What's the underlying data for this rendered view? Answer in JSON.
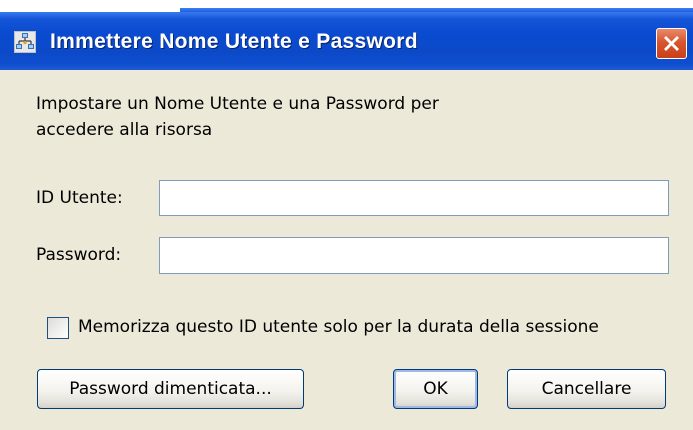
{
  "dialog": {
    "title": "Immettere Nome Utente e Password",
    "message_line1": "Impostare un Nome Utente e una Password per",
    "message_line2": "accedere alla risorsa",
    "user_id_label": "ID Utente:",
    "user_id_value": "",
    "password_label": "Password:",
    "password_value": "",
    "remember_checkbox_label": "Memorizza questo ID utente solo per la durata della sessione",
    "remember_checked": false,
    "buttons": {
      "forgot": "Password dimenticata...",
      "ok": "OK",
      "cancel": "Cancellare"
    }
  },
  "icons": {
    "app": "network-users-icon",
    "close": "close-icon"
  },
  "colors": {
    "titlebar": "#0b49c8",
    "title_text": "#ffffff",
    "client_bg": "#ece9d8",
    "close_button": "#d9562e",
    "field_border": "#7f9db9"
  }
}
